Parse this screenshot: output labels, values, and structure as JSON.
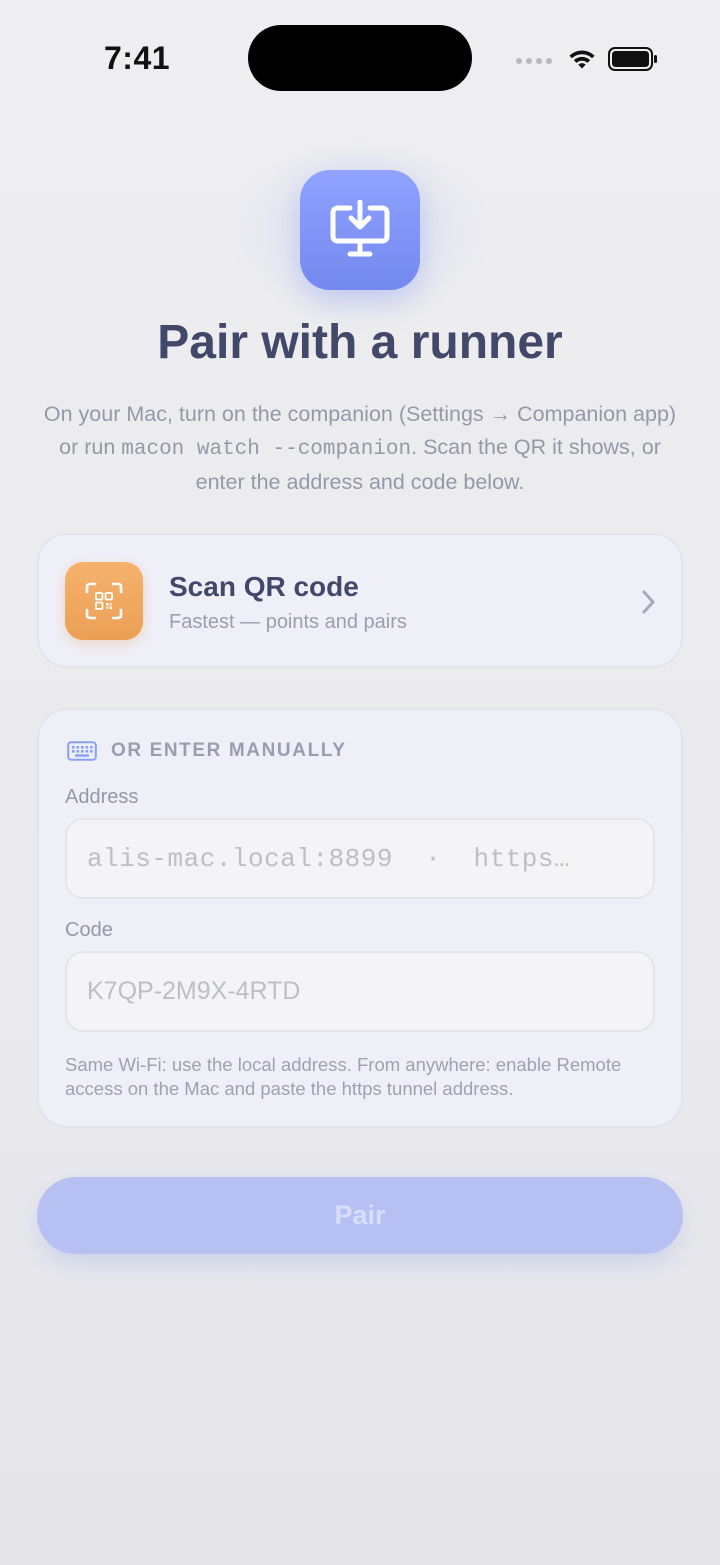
{
  "status_bar": {
    "time": "7:41"
  },
  "hero": {
    "title": "Pair with a runner",
    "subtitle_part1": "On your Mac, turn on the companion (Settings → Companion app) or run ",
    "subtitle_code": "macon watch --companion",
    "subtitle_part2": ". Scan the QR it shows, or enter the address and code below."
  },
  "scan": {
    "title": "Scan QR code",
    "subtitle": "Fastest — points and pairs"
  },
  "manual": {
    "header": "OR ENTER MANUALLY",
    "address_label": "Address",
    "address_placeholder": "alis-mac.local:8899  ·  https…",
    "code_label": "Code",
    "code_placeholder": "K7QP-2M9X-4RTD",
    "help_text": "Same Wi-Fi: use the local address. From anywhere: enable Remote access on the Mac and paste the https tunnel address."
  },
  "pair_button": {
    "label": "Pair"
  },
  "colors": {
    "accent": "#7388ee",
    "qr_badge": "#eb9f55",
    "title_text": "#414869",
    "button_disabled": "#b6c0f2"
  },
  "icons": {
    "hero": "desktop-download-icon",
    "scan": "qr-scan-icon",
    "chevron": "chevron-right-icon",
    "manual": "keyboard-icon"
  }
}
